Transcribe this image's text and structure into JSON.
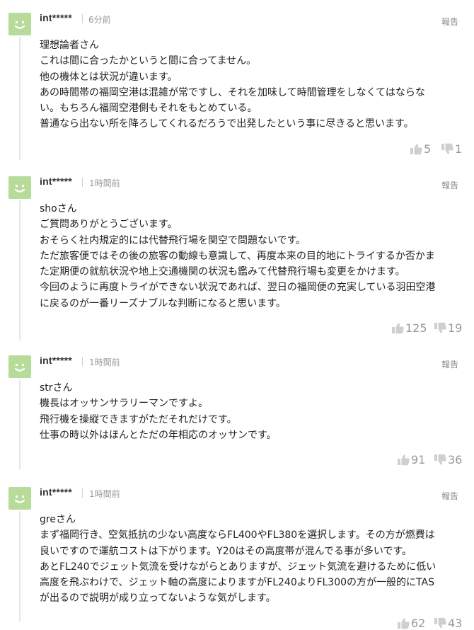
{
  "comments": [
    {
      "author": "int*****",
      "time": "6分前",
      "report": "報告",
      "lines": [
        "理想論者さん",
        "これは間に合ったかというと間に合ってません。",
        "他の機体とは状況が違います。",
        "あの時間帯の福岡空港は混雑が常ですし、それを加味して時間管理をしなくてはならな",
        "い。もちろん福岡空港側もそれをもとめている。",
        "普通なら出ない所を降ろしてくれるだろうで出発したという事に尽きると思います。"
      ],
      "likes": "5",
      "dislikes": "1"
    },
    {
      "author": "int*****",
      "time": "1時間前",
      "report": "報告",
      "lines": [
        "shoさん",
        "ご質問ありがとうございます。",
        "おそらく社内規定的には代替飛行場を関空で問題ないです。",
        "ただ旅客便ではその後の旅客の動線も意識して、再度本来の目的地にトライするか否かま",
        "た定期便の就航状況や地上交通機関の状況も鑑みて代替飛行場も変更をかけます。",
        "今回のように再度トライができない状況であれば、翌日の福岡便の充実している羽田空港",
        "に戻るのが一番リーズナブルな判断になると思います。"
      ],
      "likes": "125",
      "dislikes": "19"
    },
    {
      "author": "int*****",
      "time": "1時間前",
      "report": "報告",
      "lines": [
        "strさん",
        "機長はオッサンサラリーマンですよ。",
        "飛行機を操縦できますがただそれだけです。",
        "仕事の時以外はほんとただの年相応のオッサンです。"
      ],
      "likes": "91",
      "dislikes": "36"
    },
    {
      "author": "int*****",
      "time": "1時間前",
      "report": "報告",
      "lines": [
        "greさん",
        "まず福岡行き、空気抵抗の少ない高度ならFL400やFL380を選択します。その方が燃費は",
        "良いですので運航コストは下がります。Y20はその高度帯が混んでる事が多いです。",
        "あとFL240でジェット気流を受けながらとありますが、ジェット気流を避けるために低い",
        "高度を飛ぶわけで、ジェット軸の高度によりますがFL240よりFL300の方が一般的にTAS",
        "が出るので説明が成り立ってないような気がします。"
      ],
      "likes": "62",
      "dislikes": "43"
    }
  ],
  "colors": {
    "avatar": "#b7dc9a",
    "avatar_face": "#ffffff",
    "thread_line": "#e6e6e6",
    "muted": "#999999"
  },
  "icons": {
    "avatar": "smiley-face-icon",
    "like": "thumbs-up-icon",
    "dislike": "thumbs-down-icon"
  }
}
